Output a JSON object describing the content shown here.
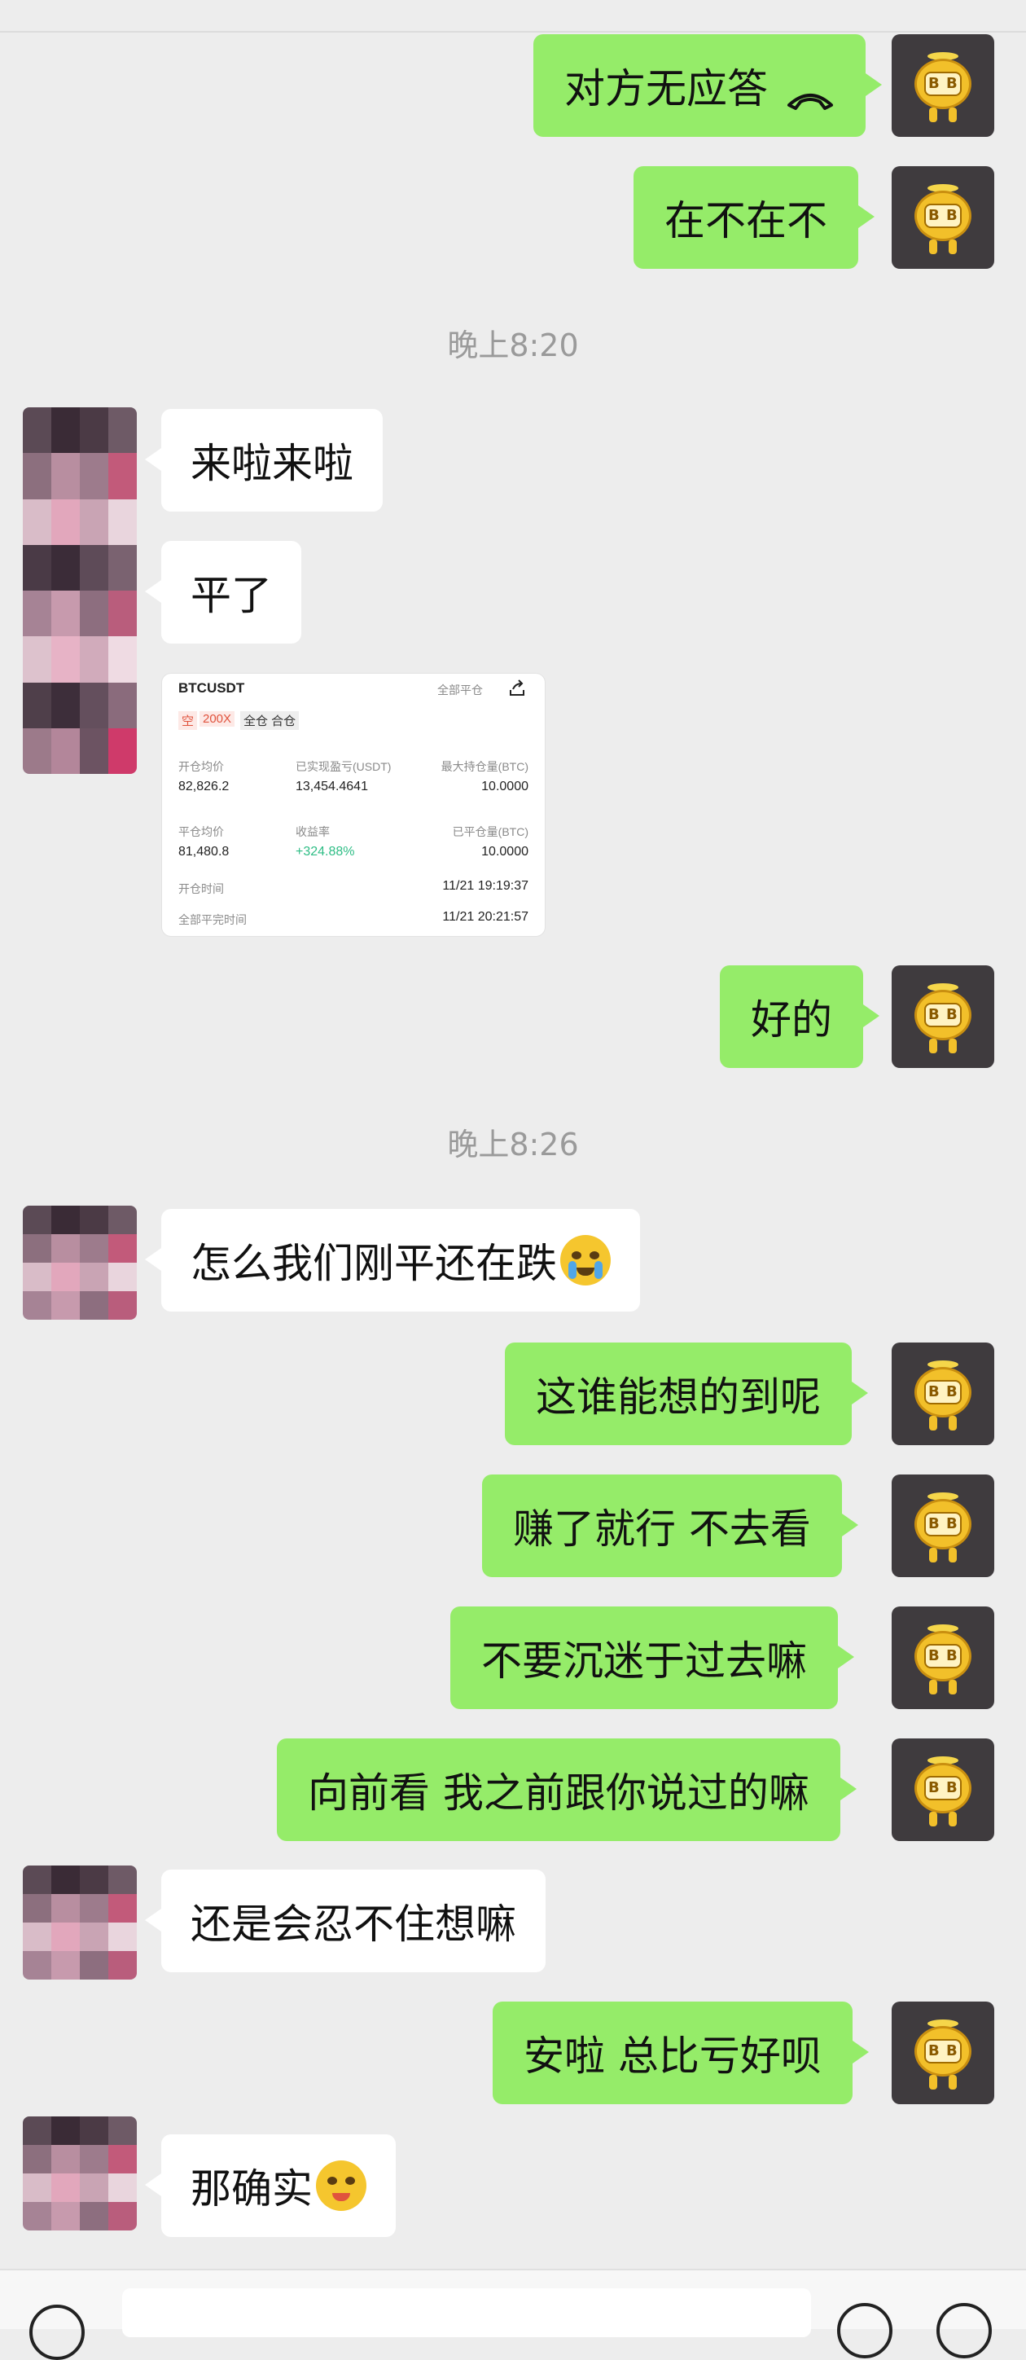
{
  "messages": {
    "m1": "对方无应答",
    "m2": "在不在不",
    "t1": "晚上8:20",
    "m3": "来啦来啦",
    "m4": "平了",
    "m5": "好的",
    "t2": "晚上8:26",
    "m6": "怎么我们刚平还在跌",
    "m7": "这谁能想的到呢",
    "m8": "赚了就行 不去看",
    "m9": "不要沉迷于过去嘛",
    "m10": "向前看 我之前跟你说过的嘛",
    "m11": "还是会忍不住想嘛",
    "m12": "安啦 总比亏好呗",
    "m13": "那确实"
  },
  "card": {
    "symbol": "BTCUSDT",
    "top_right": "全部平仓",
    "side": "空",
    "leverage": "200X",
    "margin_mode": "全仓 合仓",
    "open_avg_label": "开仓均价",
    "open_avg": "82,826.2",
    "realized_pnl_label": "已实现盈亏(USDT)",
    "realized_pnl": "13,454.4641",
    "max_pos_label": "最大持仓量(BTC)",
    "max_pos": "10.0000",
    "close_avg_label": "平仓均价",
    "close_avg": "81,480.8",
    "roi_label": "收益率",
    "roi": "+324.88%",
    "closed_label": "已平仓量(BTC)",
    "closed": "10.0000",
    "open_time_label": "开仓时间",
    "open_time": "11/21 19:19:37",
    "close_time_label": "全部平完时间",
    "close_time": "11/21 20:21:57"
  },
  "colors": {
    "my_bubble": "#95ec69",
    "their_bubble": "#ffffff",
    "background": "#ededed",
    "profit_green": "#2ebd85",
    "short_red": "#e0533d"
  },
  "icons": {
    "call_end": "phone-hangup-icon",
    "emoji_cry": "crying-emoji-icon",
    "emoji_drool": "drooling-emoji-icon",
    "share": "share-icon"
  }
}
